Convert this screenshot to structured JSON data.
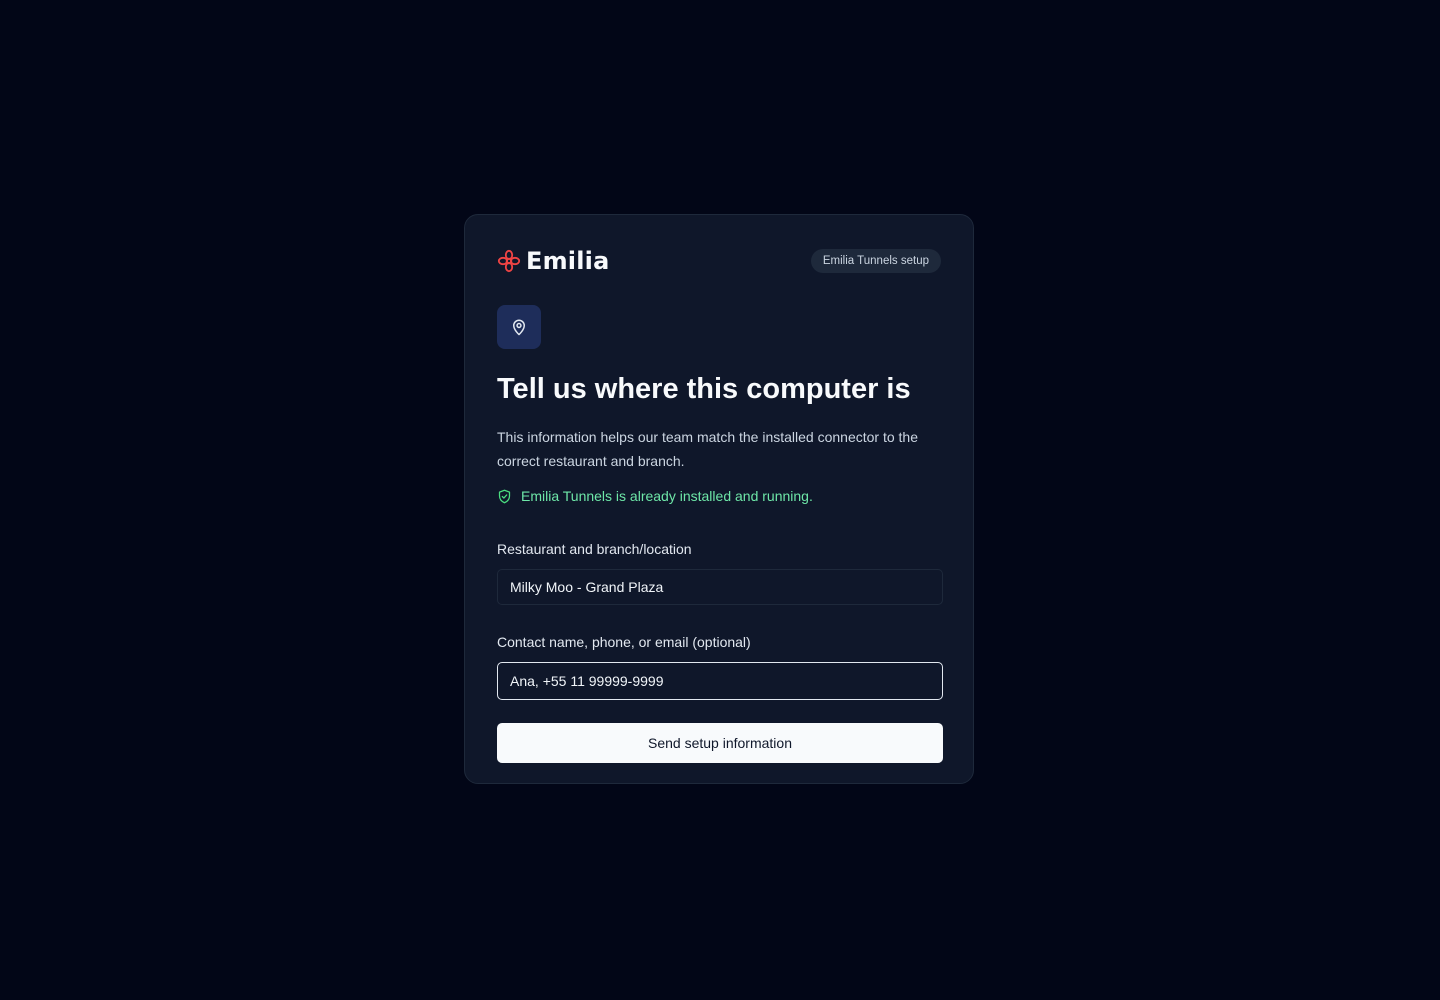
{
  "brand": {
    "name": "Emilia",
    "logo_icon": "flower-icon",
    "logo_color": "#ef4444"
  },
  "badge": "Emilia Tunnels setup",
  "header_icon": "map-pin-icon",
  "title": "Tell us where this computer is",
  "description": "This information helps our team match the installed connector to the correct restaurant and branch.",
  "status": {
    "icon": "shield-check-icon",
    "text": "Emilia Tunnels is already installed and running.",
    "color": "#4ade80"
  },
  "form": {
    "location": {
      "label": "Restaurant and branch/location",
      "value": "Milky Moo - Grand Plaza"
    },
    "contact": {
      "label": "Contact name, phone, or email (optional)",
      "value": "Ana, +55 11 99999-9999"
    },
    "submit_label": "Send setup information"
  }
}
